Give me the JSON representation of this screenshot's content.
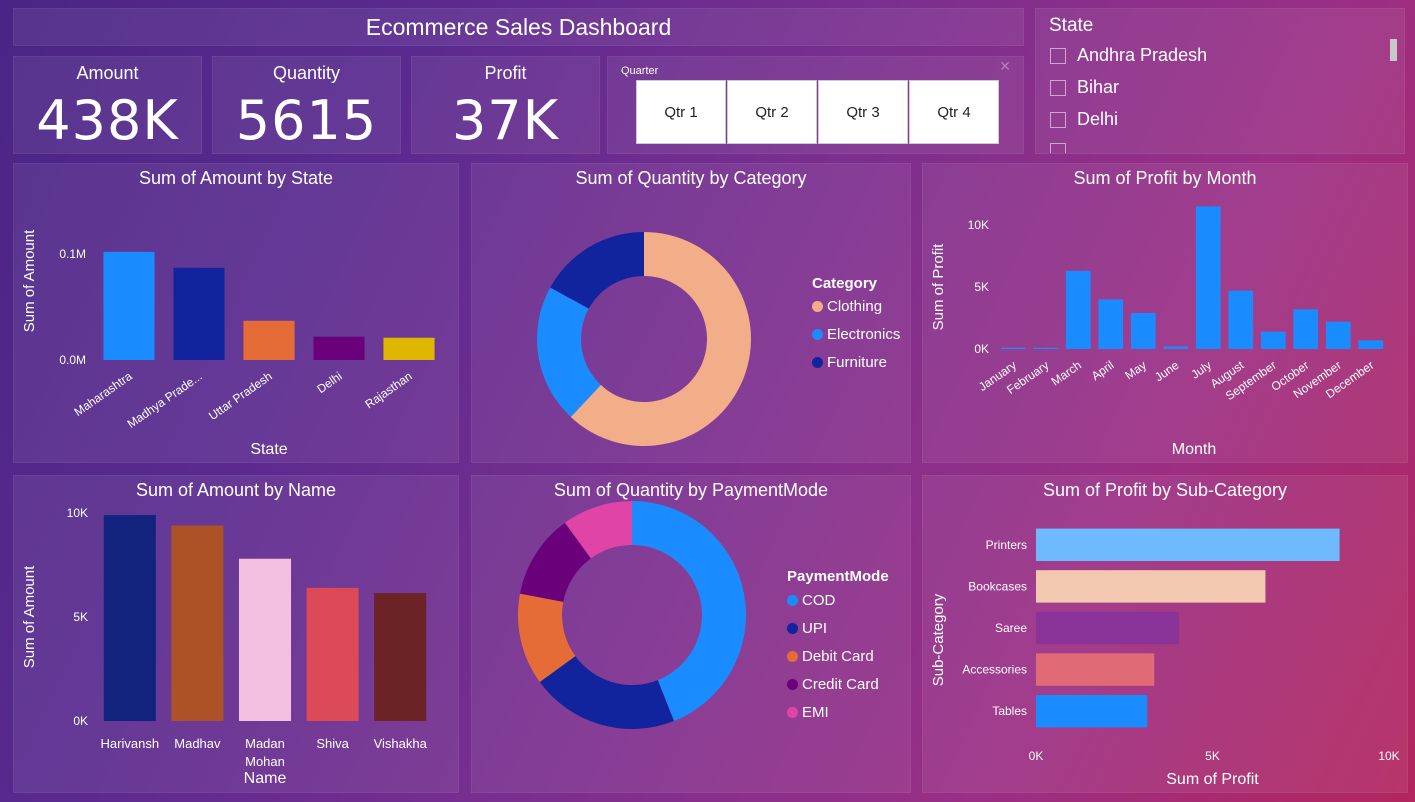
{
  "header": {
    "title": "Ecommerce Sales Dashboard"
  },
  "kpis": [
    {
      "label": "Amount",
      "value": "438K"
    },
    {
      "label": "Quantity",
      "value": "5615"
    },
    {
      "label": "Profit",
      "value": "37K"
    }
  ],
  "quarter_slicer": {
    "label": "Quarter",
    "options": [
      "Qtr 1",
      "Qtr 2",
      "Qtr 3",
      "Qtr 4"
    ]
  },
  "state_slicer": {
    "label": "State",
    "options": [
      "Andhra Pradesh",
      "Bihar",
      "Delhi"
    ]
  },
  "chart_data": [
    {
      "id": "amount_by_state",
      "type": "bar",
      "title": "Sum of Amount by State",
      "xlabel": "State",
      "ylabel": "Sum of Amount",
      "categories": [
        "Maharashtra",
        "Madhya Prade...",
        "Uttar Pradesh",
        "Delhi",
        "Rajasthan"
      ],
      "values": [
        0.102,
        0.087,
        0.037,
        0.022,
        0.021
      ],
      "colors": [
        "#1a8cff",
        "#12239e",
        "#e66c37",
        "#6b007b",
        "#e0b700"
      ],
      "yticks": [
        {
          "v": 0,
          "label": "0.0M"
        },
        {
          "v": 0.1,
          "label": "0.1M"
        }
      ],
      "ylim": [
        0,
        0.1
      ]
    },
    {
      "id": "quantity_by_category",
      "type": "pie",
      "title": "Sum of Quantity by Category",
      "legend_title": "Category",
      "slices": [
        {
          "name": "Clothing",
          "value": 62,
          "color": "#f2ad89"
        },
        {
          "name": "Electronics",
          "value": 21,
          "color": "#1a8cff"
        },
        {
          "name": "Furniture",
          "value": 17,
          "color": "#12239e"
        }
      ]
    },
    {
      "id": "profit_by_month",
      "type": "bar",
      "title": "Sum of Profit by Month",
      "xlabel": "Month",
      "ylabel": "Sum of Profit",
      "categories": [
        "January",
        "February",
        "March",
        "April",
        "May",
        "June",
        "July",
        "August",
        "September",
        "October",
        "November",
        "December"
      ],
      "values": [
        100,
        100,
        6300,
        4000,
        2900,
        200,
        11500,
        4700,
        1400,
        3200,
        2200,
        700
      ],
      "color": "#1a8cff",
      "yticks": [
        {
          "v": 0,
          "label": "0K"
        },
        {
          "v": 5000,
          "label": "5K"
        },
        {
          "v": 10000,
          "label": "10K"
        }
      ],
      "ylim": [
        0,
        10000
      ]
    },
    {
      "id": "amount_by_name",
      "type": "bar",
      "title": "Sum of Amount by Name",
      "xlabel": "Name",
      "ylabel": "Sum of Amount",
      "categories": [
        "Harivansh",
        "Madhav",
        "Madan Mohan",
        "Shiva",
        "Vishakha"
      ],
      "values": [
        9900,
        9400,
        7800,
        6400,
        6150
      ],
      "colors": [
        "#12237e",
        "#ad5126",
        "#f2bfdf",
        "#db4a56",
        "#6b2326"
      ],
      "yticks": [
        {
          "v": 0,
          "label": "0K"
        },
        {
          "v": 5000,
          "label": "5K"
        },
        {
          "v": 10000,
          "label": "10K"
        }
      ],
      "ylim": [
        0,
        10000
      ]
    },
    {
      "id": "quantity_by_paymentmode",
      "type": "pie",
      "title": "Sum of Quantity by PaymentMode",
      "legend_title": "PaymentMode",
      "slices": [
        {
          "name": "COD",
          "value": 44,
          "color": "#1a8cff"
        },
        {
          "name": "UPI",
          "value": 21,
          "color": "#12239e"
        },
        {
          "name": "Debit Card",
          "value": 13,
          "color": "#e66c37"
        },
        {
          "name": "Credit Card",
          "value": 12,
          "color": "#6b007b"
        },
        {
          "name": "EMI",
          "value": 10,
          "color": "#e044a7"
        }
      ]
    },
    {
      "id": "profit_by_subcategory",
      "type": "bar",
      "orientation": "horizontal",
      "title": "Sum of Profit by Sub-Category",
      "xlabel": "Sum of Profit",
      "ylabel": "Sub-Category",
      "categories": [
        "Printers",
        "Bookcases",
        "Saree",
        "Accessories",
        "Tables"
      ],
      "values": [
        8600,
        6500,
        4050,
        3350,
        3150
      ],
      "colors": [
        "#6fb9ff",
        "#f2c9b0",
        "#8a3499",
        "#e06b76",
        "#1a8cff"
      ],
      "xticks": [
        {
          "v": 0,
          "label": "0K"
        },
        {
          "v": 5000,
          "label": "5K"
        },
        {
          "v": 10000,
          "label": "10K"
        }
      ],
      "xlim": [
        0,
        10000
      ]
    }
  ]
}
